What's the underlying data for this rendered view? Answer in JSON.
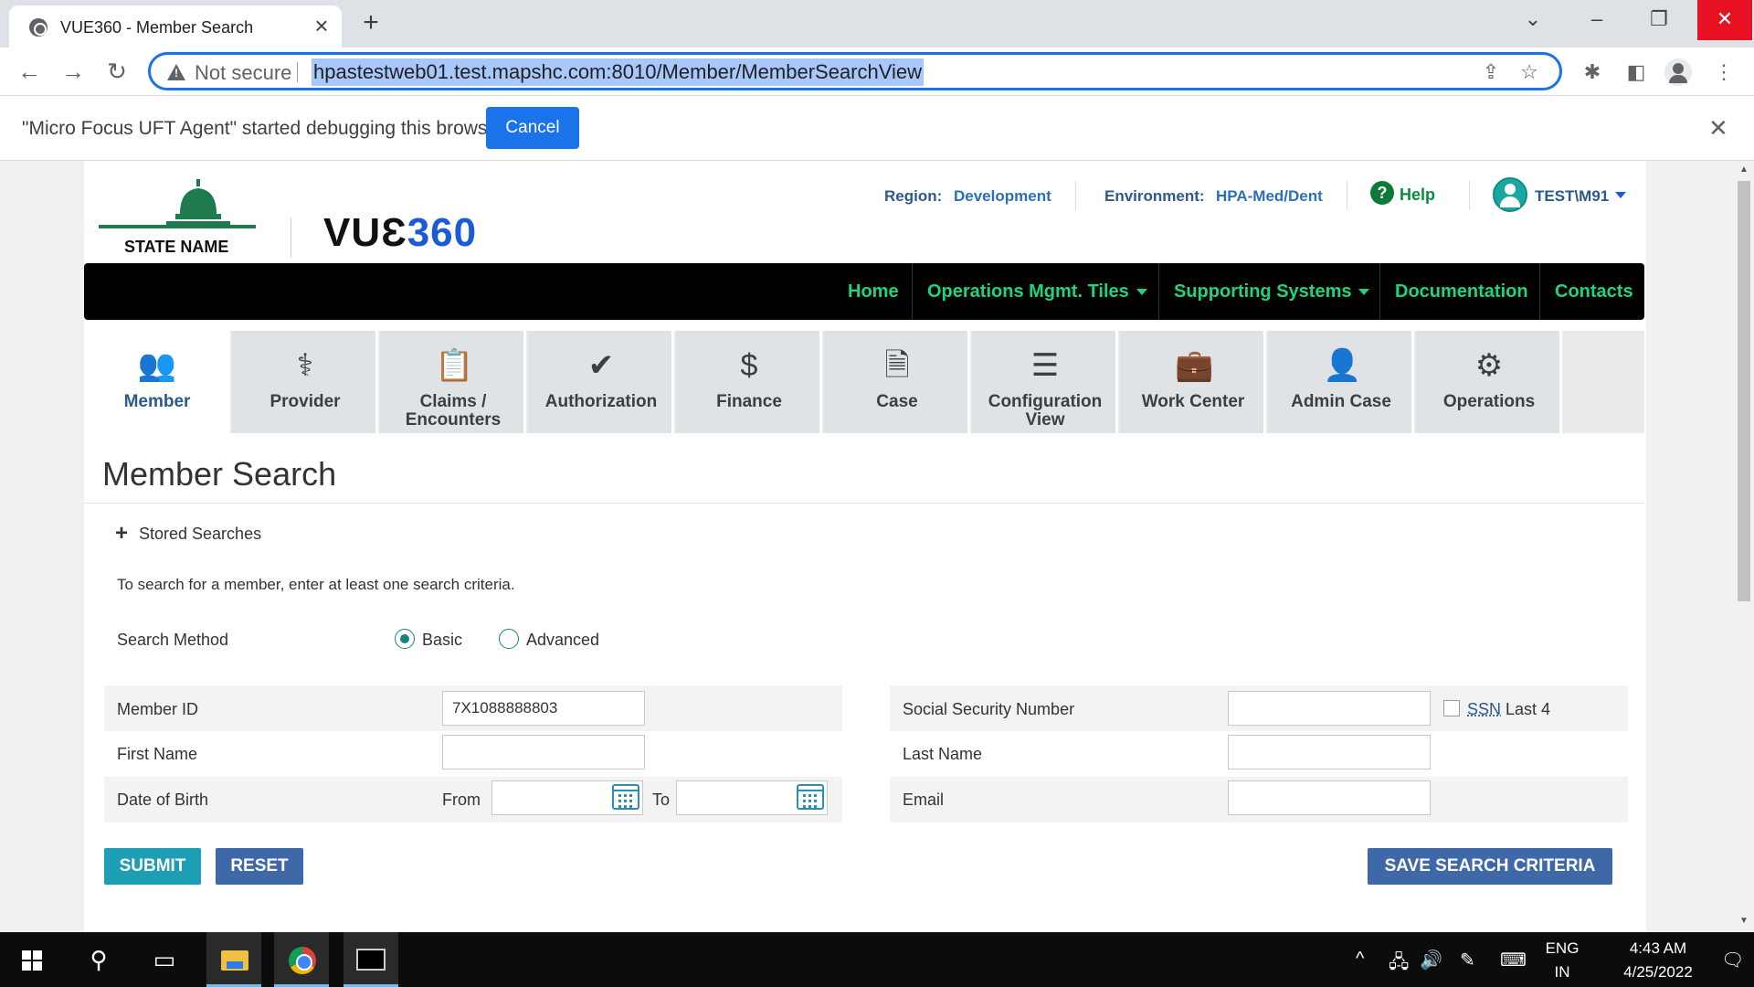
{
  "browser": {
    "tab_title": "VUE360 - Member Search",
    "security_label": "Not secure",
    "url": "hpastestweb01.test.mapshc.com:8010/Member/MemberSearchView",
    "infobar_text": "\"Micro Focus UFT Agent\" started debugging this browser",
    "infobar_cancel": "Cancel"
  },
  "header": {
    "state_name": "STATE NAME",
    "brand_part1": "VUƐ",
    "brand_part2": "360",
    "region_label": "Region:",
    "region_value": "Development",
    "env_label": "Environment:",
    "env_value": "HPA-Med/Dent",
    "help": "Help",
    "user": "TEST\\M91"
  },
  "mainnav": {
    "items": [
      {
        "label": "Home"
      },
      {
        "label": "Operations Mgmt. Tiles"
      },
      {
        "label": "Supporting Systems"
      },
      {
        "label": "Documentation"
      },
      {
        "label": "Contacts"
      }
    ]
  },
  "tiles": [
    {
      "label": "Member",
      "icon": "members-icon"
    },
    {
      "label": "Provider",
      "icon": "provider-icon"
    },
    {
      "label": "Claims /\nEncounters",
      "icon": "claims-icon"
    },
    {
      "label": "Authorization",
      "icon": "authorization-icon"
    },
    {
      "label": "Finance",
      "icon": "finance-icon"
    },
    {
      "label": "Case",
      "icon": "case-icon"
    },
    {
      "label": "Configuration\nView",
      "icon": "configuration-icon"
    },
    {
      "label": "Work Center",
      "icon": "briefcase-icon"
    },
    {
      "label": "Admin Case",
      "icon": "admin-icon"
    },
    {
      "label": "Operations",
      "icon": "gears-icon"
    }
  ],
  "search": {
    "title": "Member Search",
    "stored_searches": "Stored Searches",
    "instruction": "To search for a member, enter at least one search criteria.",
    "method_label": "Search Method",
    "method_basic": "Basic",
    "method_advanced": "Advanced",
    "method_selected": "Basic",
    "member_id_label": "Member ID",
    "member_id_value": "7X1088888803",
    "first_name_label": "First Name",
    "first_name_value": "",
    "dob_label": "Date of Birth",
    "dob_from": "From",
    "dob_to": "To",
    "ssn_label": "Social Security Number",
    "ssn_value": "",
    "ssn_link": "SSN",
    "ssn_last4": "Last 4",
    "last_name_label": "Last Name",
    "last_name_value": "",
    "email_label": "Email",
    "email_value": "",
    "submit": "SUBMIT",
    "reset": "RESET",
    "save": "SAVE SEARCH CRITERIA"
  },
  "taskbar": {
    "lang": "ENG",
    "region": "IN",
    "time": "4:43 AM",
    "date": "4/25/2022"
  },
  "colors": {
    "accent": "#1c7f82",
    "nav_text": "#1fd47a",
    "brand_blue": "#1c5bd8"
  }
}
